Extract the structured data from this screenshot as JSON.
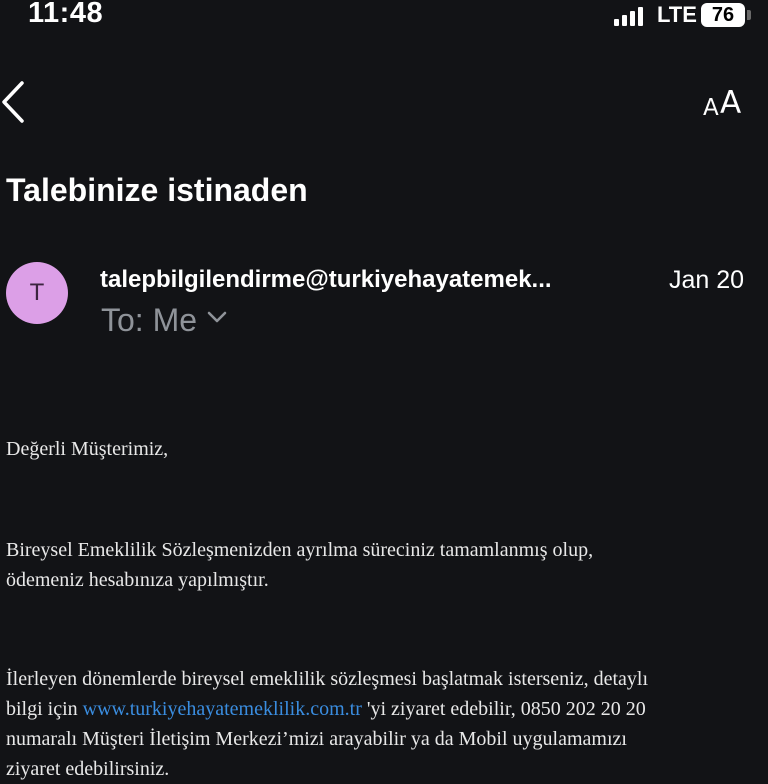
{
  "status_bar": {
    "time": "11:48",
    "network": "LTE",
    "battery": "76"
  },
  "nav": {
    "back_icon": "chevron-left-icon",
    "text_size_label_small": "A",
    "text_size_label_big": "A"
  },
  "email": {
    "subject": "Talebinize istinaden",
    "avatar_letter": "T",
    "avatar_color": "#dc9fe7",
    "sender": "talepbilgilendirme@turkiyehayatemek...",
    "date": "Jan 20",
    "recipient": "To: Me",
    "body": {
      "greeting": "Değerli Müşterimiz,",
      "paragraph1_line1": "Bireysel Emeklilik Sözleşmenizden ayrılma süreciniz tamamlanmış olup,",
      "paragraph1_line2": "ödemeniz hesabınıza yapılmıştır.",
      "paragraph2_line1": "İlerleyen dönemlerde bireysel emeklilik sözleşmesi başlatmak isterseniz, detaylı",
      "paragraph2_line2_before": "bilgi için ",
      "paragraph2_link": "www.turkiyehayatemeklilik.com.tr",
      "paragraph2_line2_after": " 'yi ziyaret edebilir, 0850 202 20 20",
      "paragraph2_line3": "numaralı Müşteri İletişim Merkezi’mizi arayabilir ya da Mobil uygulamamızı",
      "paragraph2_line4": "ziyaret edebilirsiniz."
    }
  },
  "colors": {
    "background": "#121316",
    "link": "#3a8de0",
    "muted": "#8f9399"
  }
}
